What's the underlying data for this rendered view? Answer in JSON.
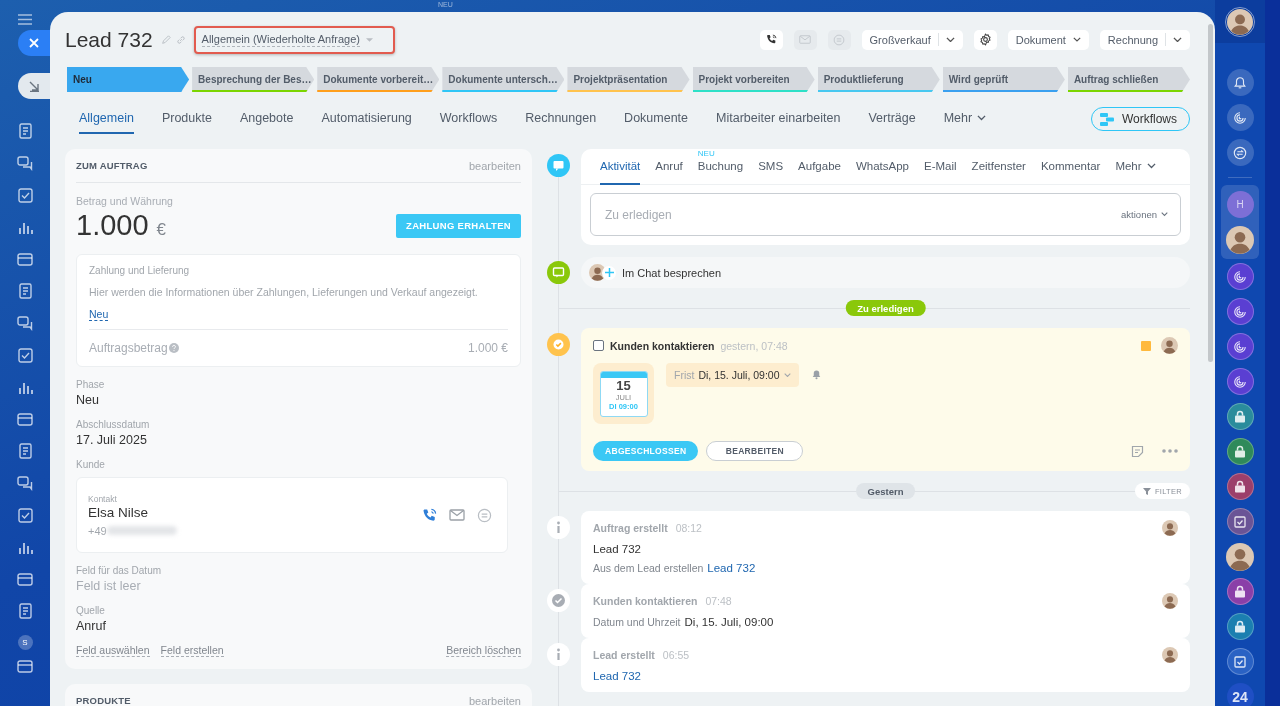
{
  "background_label": "NEU",
  "left_rail": {
    "badge": "S"
  },
  "header": {
    "title": "Lead 732",
    "category": "Allgemein (Wiederholte Anfrage)",
    "actions": [
      {
        "kind": "phone",
        "disabled": false
      },
      {
        "kind": "mail",
        "disabled": true
      },
      {
        "kind": "chat",
        "disabled": true
      },
      {
        "kind": "split",
        "label": "Großverkauf"
      },
      {
        "kind": "settings"
      },
      {
        "kind": "dropdown",
        "label": "Dokument"
      },
      {
        "kind": "split",
        "label": "Rechnung"
      }
    ]
  },
  "stages": [
    {
      "label": "Neu",
      "selected": true,
      "color": "#39a8ef"
    },
    {
      "label": "Besprechung der Bes…",
      "selected": false,
      "color": "#7bd500"
    },
    {
      "label": "Dokumente vorbereit…",
      "selected": false,
      "color": "#ff9f1c"
    },
    {
      "label": "Dokumente untersch…",
      "selected": false,
      "color": "#2fc6f6"
    },
    {
      "label": "Projektpräsentation",
      "selected": false,
      "color": "#ffc34d"
    },
    {
      "label": "Projekt vorbereiten",
      "selected": false,
      "color": "#2ee0c7"
    },
    {
      "label": "Produktlieferung",
      "selected": false,
      "color": "#47c8f0"
    },
    {
      "label": "Wird geprüft",
      "selected": false,
      "color": "#3aa0ef"
    },
    {
      "label": "Auftrag schließen",
      "selected": false,
      "color": "#7bd500"
    }
  ],
  "tabs": [
    {
      "label": "Allgemein",
      "selected": true,
      "kind": "tab"
    },
    {
      "label": "Produkte",
      "selected": false,
      "kind": "tab"
    },
    {
      "label": "Angebote",
      "selected": false,
      "kind": "tab"
    },
    {
      "label": "Automatisierung",
      "selected": false,
      "kind": "tab"
    },
    {
      "label": "Workflows",
      "selected": false,
      "kind": "tab"
    },
    {
      "label": "Rechnungen",
      "selected": false,
      "kind": "tab"
    },
    {
      "label": "Dokumente",
      "selected": false,
      "kind": "tab"
    },
    {
      "label": "Mitarbeiter einarbeiten",
      "selected": false,
      "kind": "tab"
    },
    {
      "label": "Verträge",
      "selected": false,
      "kind": "tab"
    },
    {
      "label": "Mehr",
      "selected": false,
      "kind": "menu"
    }
  ],
  "workflows_button": "Workflows",
  "order_card": {
    "title": "ZUM AUFTRAG",
    "action": "bearbeiten",
    "amount_label": "Betrag und Währung",
    "amount": "1.000",
    "currency": "€",
    "pay_button": "ZAHLUNG ERHALTEN",
    "payment_box": {
      "title": "Zahlung und Lieferung",
      "text": "Hier werden die Informationen über Zahlungen, Lieferungen und Verkauf angezeigt.",
      "link": "Neu",
      "total_label": "Auftragsbetrag",
      "total": "1.000 €"
    },
    "fields": [
      {
        "kind": "text",
        "label": "Phase",
        "value": "Neu",
        "empty": false
      },
      {
        "kind": "text",
        "label": "Abschlussdatum",
        "value": "17. Juli 2025",
        "empty": false
      },
      {
        "kind": "contact",
        "label": "Kunde",
        "contact_label": "Kontakt",
        "name": "Elsa Nilse",
        "phone": "+49"
      },
      {
        "kind": "text",
        "label": "Feld für das Datum",
        "value": "Feld ist leer",
        "empty": true
      },
      {
        "kind": "text",
        "label": "Quelle",
        "value": "Anruf",
        "empty": false
      }
    ],
    "footer_links": [
      "Feld auswählen",
      "Feld erstellen"
    ],
    "remove_link": "Bereich löschen"
  },
  "products_card": {
    "title": "PRODUKTE",
    "action": "bearbeiten"
  },
  "activity": {
    "tabs": [
      {
        "label": "Aktivität",
        "selected": true,
        "kind": "tab"
      },
      {
        "label": "Anruf",
        "selected": false,
        "kind": "tab"
      },
      {
        "label": "Buchung",
        "selected": false,
        "kind": "tab",
        "badge": "NEU"
      },
      {
        "label": "SMS",
        "selected": false,
        "kind": "tab"
      },
      {
        "label": "Aufgabe",
        "selected": false,
        "kind": "tab"
      },
      {
        "label": "WhatsApp",
        "selected": false,
        "kind": "tab"
      },
      {
        "label": "E-Mail",
        "selected": false,
        "kind": "tab"
      },
      {
        "label": "Zeitfenster",
        "selected": false,
        "kind": "tab"
      },
      {
        "label": "Kommentar",
        "selected": false,
        "kind": "tab"
      },
      {
        "label": "Mehr",
        "selected": false,
        "kind": "menu"
      }
    ],
    "placeholder": "Zu erledigen",
    "actions_label": "aktionen"
  },
  "chat_row": "Im Chat besprechen",
  "todo_divider": "Zu erledigen",
  "task": {
    "checked": false,
    "title": "Kunden kontaktieren",
    "time": "gestern, 07:48",
    "calendar": {
      "day": "15",
      "month": "JULI",
      "time": "DI 09:00"
    },
    "deadline_label": "Frist",
    "deadline": "Di, 15. Juli, 09:00",
    "buttons": [
      "ABGESCHLOSSEN",
      "BEARBEITEN"
    ]
  },
  "history_divider": "Gestern",
  "filter_button": "FILTER",
  "events": [
    {
      "kind": "info",
      "title": "Auftrag erstellt",
      "time": "08:12",
      "lines": [
        {
          "value": "Lead 732"
        },
        {
          "label": "Aus dem Lead erstellen",
          "link": "Lead 732"
        }
      ]
    },
    {
      "kind": "done",
      "title": "Kunden kontaktieren",
      "time": "07:48",
      "lines": [
        {
          "label": "Datum und Uhrzeit",
          "value": "Di, 15. Juli, 09:00"
        }
      ]
    },
    {
      "kind": "info",
      "title": "Lead erstellt",
      "time": "06:55",
      "lines": [
        {
          "link": "Lead 732"
        }
      ]
    }
  ],
  "right_rail": {
    "tools": [
      {
        "kind": "bell"
      },
      {
        "kind": "spiral"
      },
      {
        "kind": "chat"
      }
    ],
    "group": [
      {
        "kind": "letter",
        "text": "H",
        "color": "#7d6fd6"
      },
      {
        "kind": "avatar"
      }
    ],
    "chats": [
      {
        "kind": "spiral",
        "color": "#5a3fd2"
      },
      {
        "kind": "spiral",
        "color": "#5a3fd2"
      },
      {
        "kind": "spiral",
        "color": "#5a3fd2"
      },
      {
        "kind": "spiral",
        "color": "#5a3fd2"
      },
      {
        "kind": "lock",
        "color": "#2a8c9c"
      },
      {
        "kind": "lock",
        "color": "#2f8a5a"
      },
      {
        "kind": "lock",
        "color": "#9c3f6a"
      },
      {
        "kind": "task",
        "color": "#6a5496"
      },
      {
        "kind": "avatar"
      },
      {
        "kind": "lock",
        "color": "#8a3fa8"
      },
      {
        "kind": "lock",
        "color": "#1b7fb0"
      },
      {
        "kind": "task",
        "color": "#2a62c4"
      },
      {
        "kind": "logo",
        "text": "24",
        "color": "#1f4fc4"
      }
    ]
  }
}
